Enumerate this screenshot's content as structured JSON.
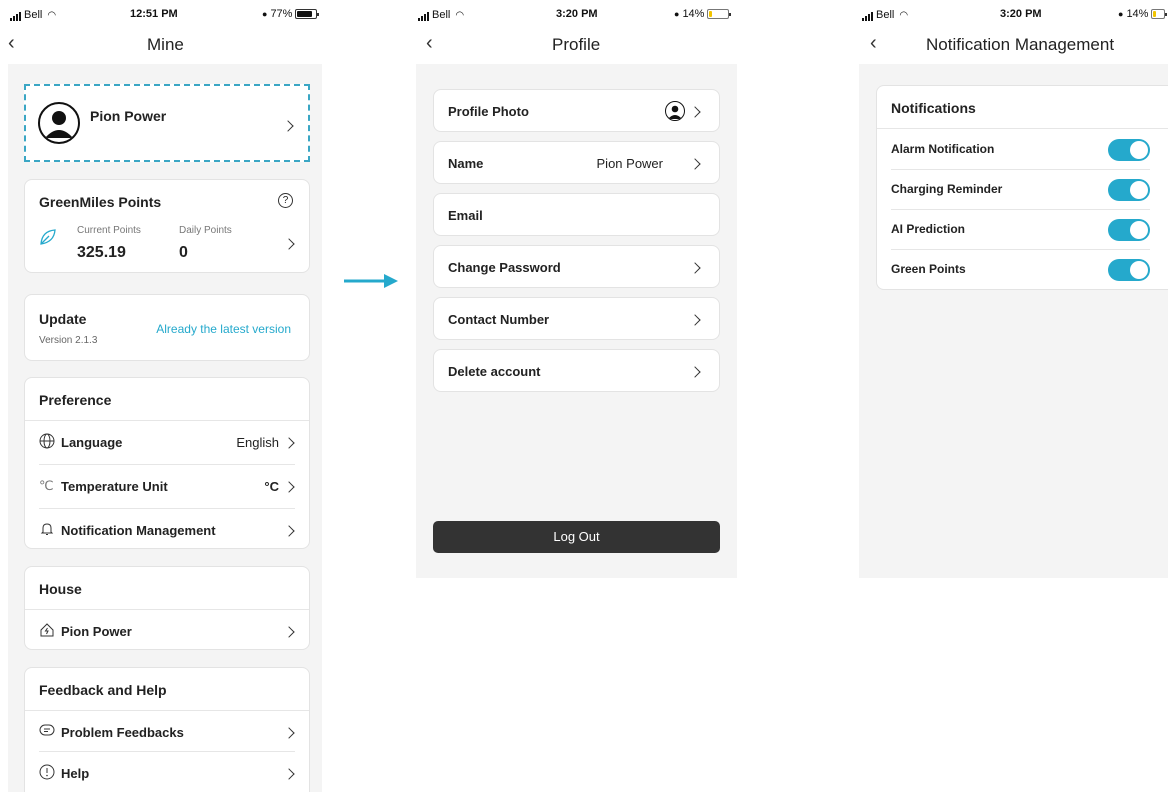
{
  "colors": {
    "accent": "#25a9cc",
    "logout_bg": "#333333",
    "page_bg": "#f4f4f4"
  },
  "screen1": {
    "status": {
      "carrier": "Bell",
      "time": "12:51 PM",
      "battery": "77%",
      "battery_level": 0.77
    },
    "title": "Mine",
    "profile": {
      "name": "Pion Power",
      "avatar_icon": "user-avatar-icon"
    },
    "points": {
      "title": "GreenMiles Points",
      "current_label": "Current Points",
      "current_value": "325.19",
      "daily_label": "Daily Points",
      "daily_value": "0",
      "help_icon": "question-circle-icon",
      "leaf_icon": "leaf-icon"
    },
    "update": {
      "title": "Update",
      "version": "Version 2.1.3",
      "status": "Already the latest version"
    },
    "preference": {
      "title": "Preference",
      "items": [
        {
          "label": "Language",
          "value": "English",
          "icon": "globe-icon"
        },
        {
          "label": "Temperature Unit",
          "value": "°C",
          "icon": "thermometer-icon"
        },
        {
          "label": "Notification Management",
          "value": "",
          "icon": "bell-icon"
        }
      ]
    },
    "house": {
      "title": "House",
      "items": [
        {
          "label": "Pion Power",
          "icon": "house-icon"
        }
      ]
    },
    "feedback": {
      "title": "Feedback and Help",
      "items": [
        {
          "label": "Problem Feedbacks",
          "icon": "chat-icon"
        },
        {
          "label": "Help",
          "icon": "info-circle-icon"
        }
      ]
    }
  },
  "screen2": {
    "status": {
      "carrier": "Bell",
      "time": "3:20 PM",
      "battery": "14%",
      "battery_level": 0.14
    },
    "title": "Profile",
    "rows": [
      {
        "label": "Profile Photo",
        "value": ""
      },
      {
        "label": "Name",
        "value": "Pion Power"
      },
      {
        "label": "Email",
        "value": ""
      },
      {
        "label": "Change Password",
        "value": ""
      },
      {
        "label": "Contact Number",
        "value": ""
      },
      {
        "label": "Delete account",
        "value": ""
      }
    ],
    "logout": "Log Out"
  },
  "screen3": {
    "status": {
      "carrier": "Bell",
      "time": "3:20 PM",
      "battery": "14%",
      "battery_level": 0.14
    },
    "title": "Notification Management",
    "section": "Notifications",
    "items": [
      {
        "label": "Alarm Notification",
        "on": true
      },
      {
        "label": "Charging Reminder",
        "on": true
      },
      {
        "label": "AI Prediction",
        "on": true
      },
      {
        "label": "Green Points",
        "on": true
      }
    ]
  }
}
